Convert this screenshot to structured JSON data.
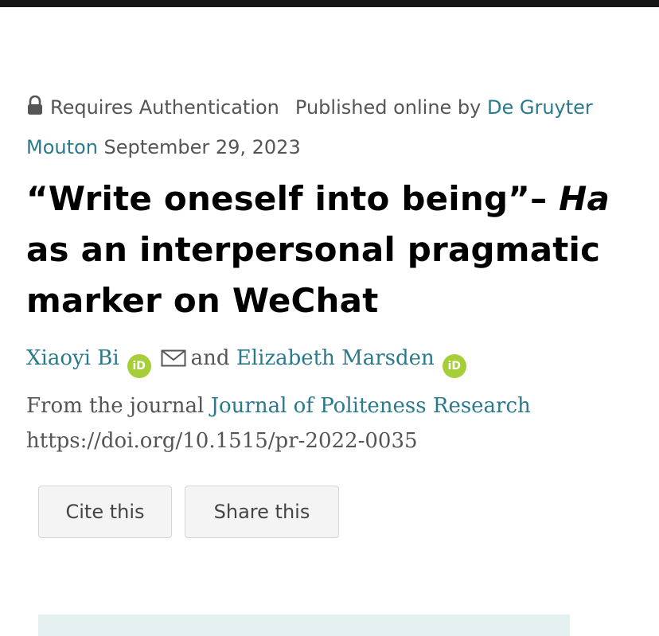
{
  "access": {
    "label": "Requires Authentication",
    "published_prefix": "Published online by",
    "publisher": "De Gruyter Mouton",
    "date": "September 29, 2023"
  },
  "article": {
    "title_main": "“Write oneself into being”– ",
    "title_italic": "Ha",
    "title_rest": " as an interpersonal pragmatic marker on WeChat"
  },
  "authors": {
    "author1": "Xiaoyi Bi",
    "connector": "and",
    "author2": "Elizabeth Marsden",
    "orcid_label": "iD"
  },
  "journal": {
    "prefix": "From the journal",
    "name": "Journal of Politeness Research",
    "doi": "https://doi.org/10.1515/pr-2022-0035"
  },
  "actions": {
    "cite_label": "Cite this",
    "share_label": "Share this"
  },
  "icons": {
    "lock": "lock-icon",
    "orcid": "orcid-icon",
    "mail": "mail-icon"
  },
  "colors": {
    "link": "#2a7a8c",
    "orcid": "#a6ce39",
    "panel": "#e5f0f1"
  }
}
